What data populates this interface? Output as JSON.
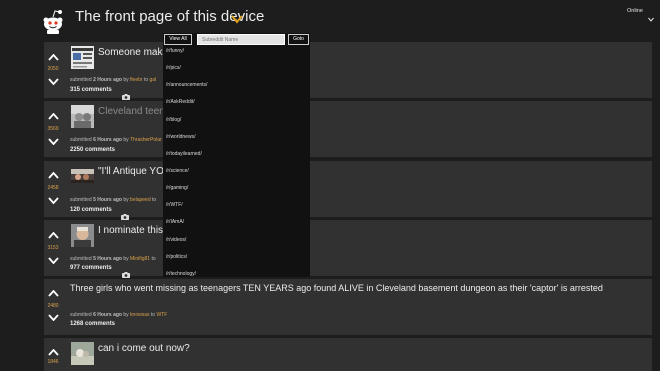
{
  "header": {
    "title": "The front page of this device",
    "status": "Online"
  },
  "dropdown": {
    "view_all_label": "View All",
    "input_placeholder": "Subreddit Name",
    "goto_label": "Goto",
    "subreddits": [
      "/r/funny/",
      "/r/pics/",
      "/r/announcements/",
      "/r/AskReddit/",
      "/r/blog/",
      "/r/worldnews/",
      "/r/todayilearned/",
      "/r/science/",
      "/r/gaming/",
      "/r/WTF/",
      "/r/IAmA/",
      "/r/videos/",
      "/r/politics/",
      "/r/technology/"
    ]
  },
  "posts": [
    {
      "score": "2050",
      "title": "Someone make t",
      "submitted": "submitted",
      "time": "2 Hours ago",
      "by": "by",
      "user": "fleebr",
      "to": "to",
      "sub": "gal",
      "comments": "315 comments"
    },
    {
      "score": "3569",
      "title": "Cleveland teens f",
      "submitted": "submitted",
      "time": "6 Hours ago",
      "by": "by",
      "user": "ThrasherPolar",
      "to": "to",
      "sub": "",
      "comments": "2250 comments"
    },
    {
      "score": "2458",
      "title": "\"I'll Antique YOUR",
      "submitted": "submitted",
      "time": "5 Hours ago",
      "by": "by",
      "user": "belapeed",
      "to": "to",
      "sub": "",
      "comments": "120 comments"
    },
    {
      "score": "3153",
      "title": "I nominate this gu",
      "submitted": "submitted",
      "time": "5 Hours ago",
      "by": "by",
      "user": "Minifig81",
      "to": "to",
      "sub": "",
      "comments": "977 comments"
    },
    {
      "score": "2480",
      "title": "Three girls who went missing as teenagers TEN YEARS ago found ALIVE in Cleveland basement dungeon as their 'captor' is arrested",
      "submitted": "submitted",
      "time": "6 Hours ago",
      "by": "by",
      "user": "knowsas",
      "to": "to",
      "sub": "WTF",
      "comments": "1268 comments"
    },
    {
      "score": "1846",
      "title": "can i come out now?",
      "submitted": "",
      "time": "",
      "by": "",
      "user": "",
      "to": "",
      "sub": "",
      "comments": ""
    }
  ]
}
